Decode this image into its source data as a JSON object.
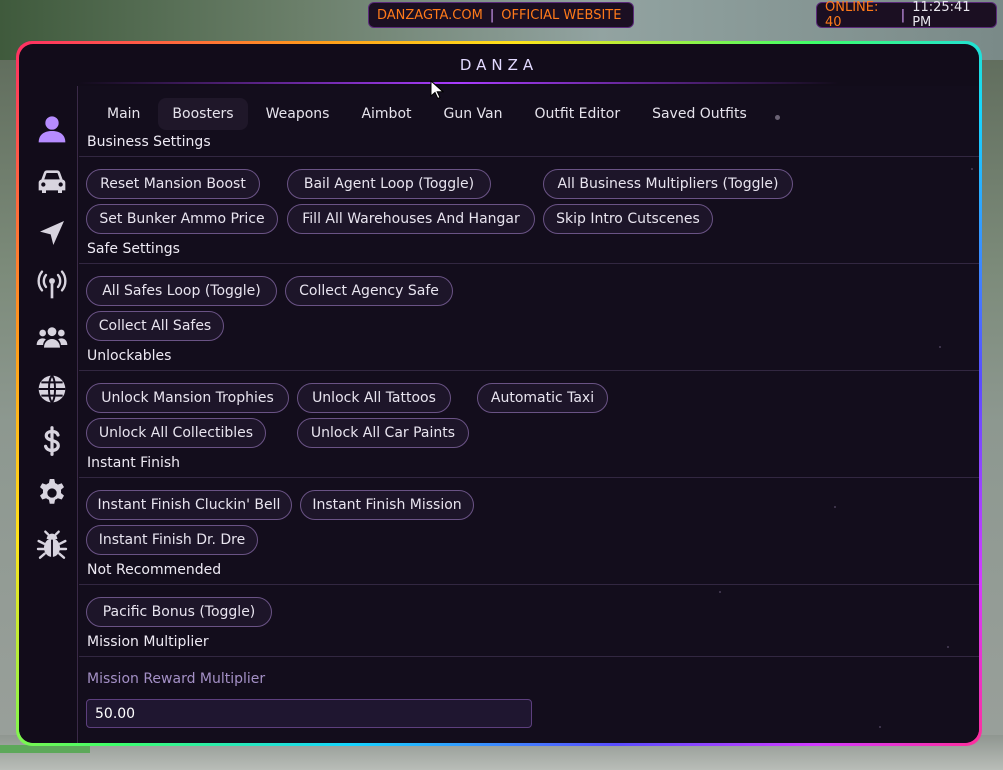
{
  "topbar": {
    "site_text": "DANZAGTA.COM",
    "separator": "|",
    "official_text": "OFFICIAL WEBSITE",
    "online_text": "ONLINE: 40",
    "time_text": "11:25:41 PM"
  },
  "menu": {
    "title": "DANZA",
    "tabs": [
      "Main",
      "Boosters",
      "Weapons",
      "Aimbot",
      "Gun Van",
      "Outfit Editor",
      "Saved Outfits"
    ],
    "active_tab": "Boosters"
  },
  "sidebar": {
    "icons": [
      "user-icon",
      "car-icon",
      "navigation-icon",
      "broadcast-tower-icon",
      "users-group-icon",
      "globe-icon",
      "dollar-icon",
      "gear-icon",
      "bug-icon"
    ]
  },
  "sections": {
    "business": {
      "title": "Business Settings",
      "buttons": [
        "Reset Mansion Boost",
        "Bail Agent Loop (Toggle)",
        "All Business Multipliers (Toggle)",
        "Set Bunker Ammo Price",
        "Fill All Warehouses And Hangar",
        "Skip Intro Cutscenes"
      ]
    },
    "safe": {
      "title": "Safe Settings",
      "buttons": [
        "All Safes Loop (Toggle)",
        "Collect Agency Safe",
        "Collect All Safes"
      ]
    },
    "unlockables": {
      "title": "Unlockables",
      "buttons": [
        "Unlock Mansion Trophies",
        "Unlock All Tattoos",
        "Automatic Taxi",
        "Unlock All Collectibles",
        "Unlock All Car Paints"
      ]
    },
    "instant": {
      "title": "Instant Finish",
      "buttons": [
        "Instant Finish Cluckin' Bell",
        "Instant Finish Mission",
        "Instant Finish Dr. Dre"
      ]
    },
    "not_recommended": {
      "title": "Not Recommended",
      "buttons": [
        "Pacific Bonus (Toggle)"
      ]
    },
    "mission_multiplier": {
      "title": "Mission Multiplier",
      "label": "Mission Reward Multiplier",
      "value": "50.00"
    }
  },
  "colors": {
    "accent": "#a93cff",
    "topbar_text": "#ff7a1a",
    "panel_bg": "#130d1c"
  }
}
